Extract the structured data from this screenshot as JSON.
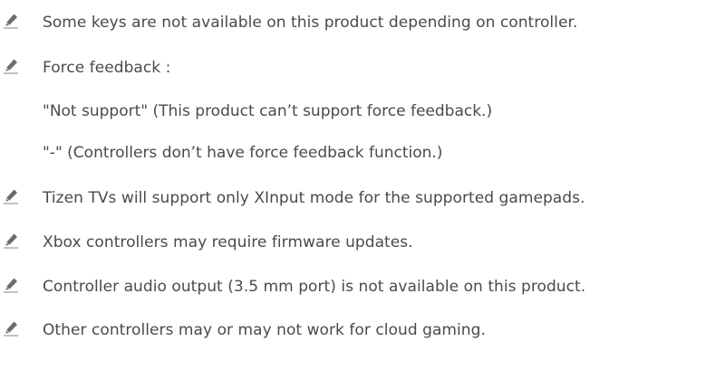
{
  "notes": [
    {
      "icon": "pencil-note-icon",
      "text": "Some keys are not available on this product depending on controller."
    },
    {
      "icon": "pencil-note-icon",
      "text": "Force feedback :",
      "sub": [
        "\"Not support\" (This product can’t support force feedback.)",
        "\"-\" (Controllers don’t have force feedback function.)"
      ]
    },
    {
      "icon": "pencil-note-icon",
      "text": "Tizen TVs will support only XInput mode for the supported gamepads."
    },
    {
      "icon": "pencil-note-icon",
      "text": "Xbox controllers may require firmware updates."
    },
    {
      "icon": "pencil-note-icon",
      "text": "Controller audio output (3.5 mm port) is not available on this product."
    },
    {
      "icon": "pencil-note-icon",
      "text": "Other controllers may or may not work for cloud gaming."
    }
  ],
  "colors": {
    "text": "#4a4a4a",
    "icon": "#6b6b6b",
    "underline": "#9a9a9a"
  }
}
